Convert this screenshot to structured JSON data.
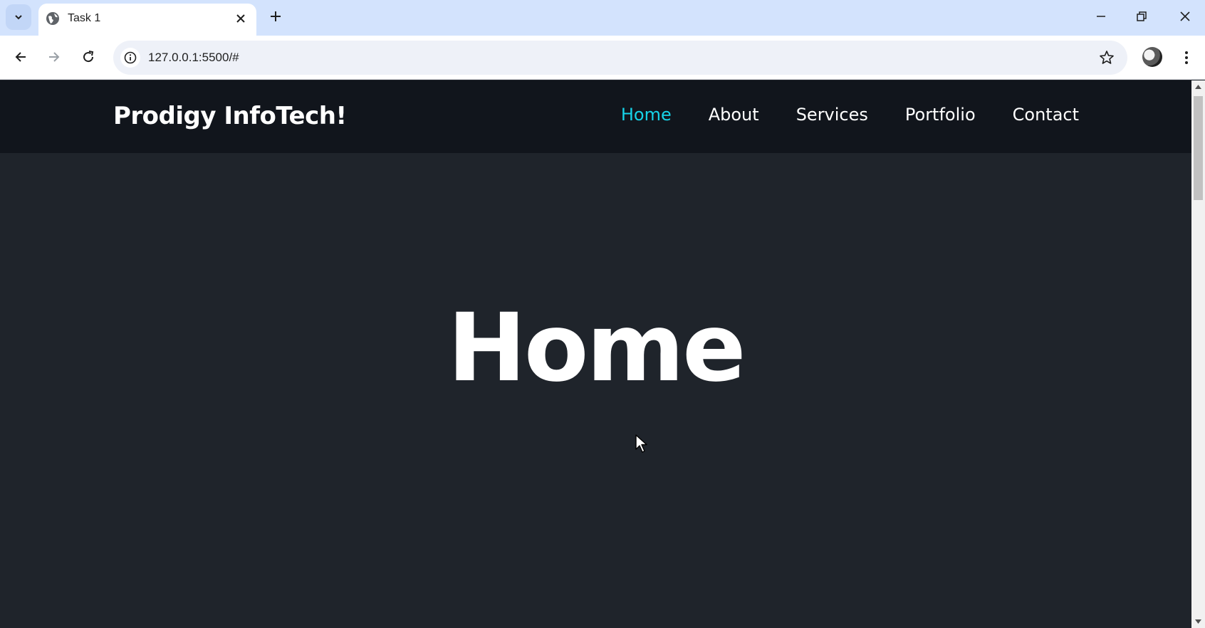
{
  "browser": {
    "tab": {
      "title": "Task 1"
    },
    "address_bar": {
      "url": "127.0.0.1:5500/#"
    }
  },
  "site": {
    "logo": "Prodigy InfoTech!",
    "nav": [
      {
        "label": "Home",
        "active": true
      },
      {
        "label": "About",
        "active": false
      },
      {
        "label": "Services",
        "active": false
      },
      {
        "label": "Portfolio",
        "active": false
      },
      {
        "label": "Contact",
        "active": false
      }
    ],
    "hero_title": "Home"
  },
  "colors": {
    "tabstrip_bg": "#d3e3fd",
    "header_bg": "#11151c",
    "page_bg": "#1f242b",
    "nav_active": "#16d3e8",
    "text": "#ffffff"
  },
  "icons": {
    "tab_search": "chevron-down-icon",
    "favicon": "globe-icon",
    "tab_close": "close-icon",
    "new_tab": "plus-icon",
    "back": "arrow-left-icon",
    "forward": "arrow-right-icon",
    "reload": "reload-icon",
    "site_info": "info-icon",
    "bookmark": "star-icon",
    "menu": "kebab-menu-icon"
  }
}
